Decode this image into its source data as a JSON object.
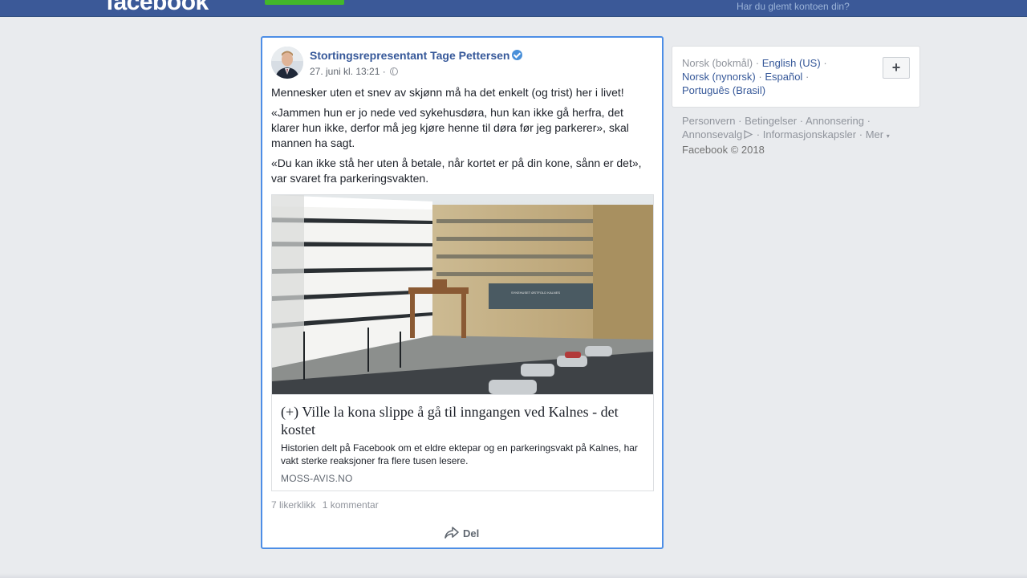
{
  "topbar": {
    "logo": "facebook",
    "forgot_account": "Har du glemt kontoen din?"
  },
  "post": {
    "author": "Stortingsrepresentant Tage Pettersen",
    "timestamp": "27. juni kl. 13:21",
    "meta_separator": "·",
    "paragraphs": [
      "Mennesker uten et snev av skjønn må ha det enkelt (og trist) her i livet!",
      "«Jammen hun er jo nede ved sykehusdøra, hun kan ikke gå herfra, det klarer hun ikke, derfor må jeg kjøre henne til døra før jeg parkerer», skal mannen ha sagt.",
      "«Du kan ikke stå her uten å betale, når kortet er på din kone, sånn er det», var svaret fra parkeringsvakten."
    ],
    "link": {
      "title": "(+) Ville la kona slippe å gå til inngangen ved Kalnes - det kostet",
      "description": "Historien delt på Facebook om et eldre ektepar og en parkeringsvakt på Kalnes, har vakt sterke reaksjoner fra flere tusen lesere.",
      "domain": "MOSS-AVIS.NO",
      "sign_text": "SYKEHUSET ØSTFOLD KALNES"
    },
    "likes": "7 likerklikk",
    "comments": "1 kommentar",
    "share_label": "Del"
  },
  "languages": {
    "current": "Norsk (bokmål)",
    "others": [
      "English (US)",
      "Norsk (nynorsk)",
      "Español",
      "Português (Brasil)"
    ],
    "separator": "·",
    "add_label": "+"
  },
  "footer": {
    "links": [
      "Personvern",
      "Betingelser",
      "Annonsering",
      "Annonsevalg",
      "Informasjonskapsler",
      "Mer"
    ],
    "separator": "·",
    "copyright": "Facebook © 2018"
  },
  "colors": {
    "topbar": "#3b5998",
    "link": "#365899",
    "verified": "#4a90d9",
    "focus_border": "#4d8ee6",
    "signup": "#42b72a"
  }
}
